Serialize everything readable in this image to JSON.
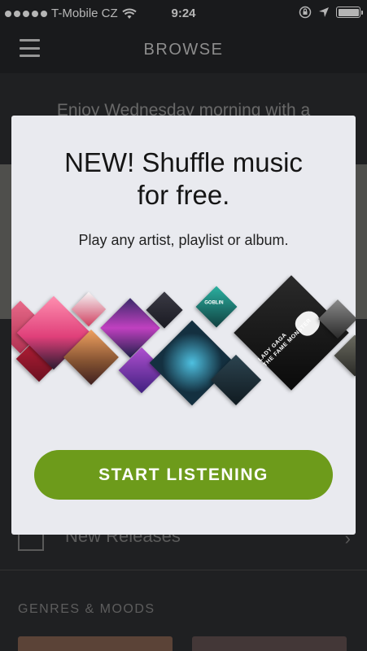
{
  "status_bar": {
    "carrier": "T-Mobile CZ",
    "time": "9:24"
  },
  "nav": {
    "title": "BROWSE"
  },
  "background": {
    "promo_text": "Enjoy Wednesday morning with a",
    "list_item_label": "New Releases",
    "section_header": "GENRES & MOODS"
  },
  "modal": {
    "title_line1": "NEW! Shuffle music",
    "title_line2": "for free.",
    "subtitle": "Play any artist, playlist or album.",
    "cta_label": "START LISTENING",
    "album_art_text": [
      "GOBLIN",
      "LADY GAGA",
      "THE FAME MONSTER"
    ]
  },
  "colors": {
    "accent_green": "#6d9b1b",
    "modal_background": "#e9eaef",
    "app_background": "#2a2b2e"
  }
}
